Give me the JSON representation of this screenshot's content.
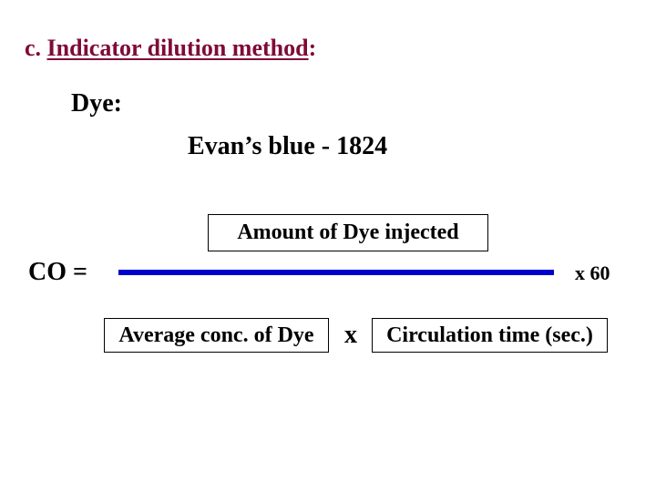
{
  "slide": {
    "title_prefix": "c. ",
    "title_main": "Indicator dilution method",
    "title_suffix": ":",
    "dye_label": "Dye:",
    "dye_name": "Evan’s blue - 1824",
    "formula": {
      "lhs": "CO =",
      "numerator": "Amount of Dye injected",
      "denominator_left": "Average conc. of Dye",
      "operator": "x",
      "denominator_right": "Circulation time (sec.)",
      "multiplier": "x 60"
    },
    "colors": {
      "title": "#7f0a37",
      "fraction_line": "#0000cc"
    }
  }
}
